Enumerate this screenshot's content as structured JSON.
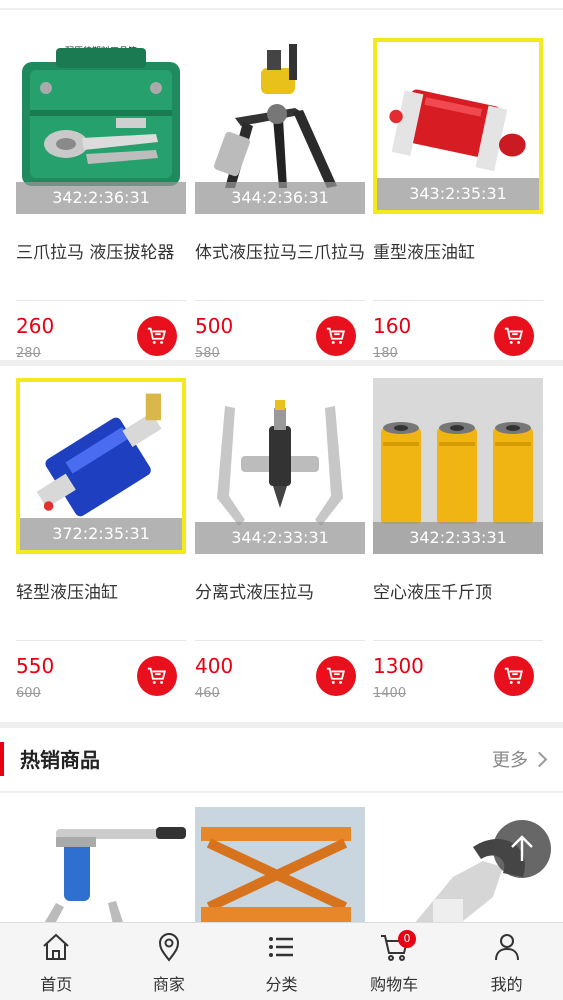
{
  "products_row1": [
    {
      "timer": "342:2:36:31",
      "name": "三爪拉马 液压拔轮器",
      "price": "260",
      "old_price": "280",
      "highlighted": false,
      "image": "green-toolbox-puller-kit",
      "caption": "配原装塑料工具箱"
    },
    {
      "timer": "344:2:36:31",
      "name": "体式液压拉马三爪拉马",
      "price": "500",
      "old_price": "580",
      "highlighted": false,
      "image": "integral-three-jaw-puller"
    },
    {
      "timer": "343:2:35:31",
      "name": "重型液压油缸",
      "price": "160",
      "old_price": "180",
      "highlighted": true,
      "image": "red-hydraulic-cylinder"
    }
  ],
  "products_row2": [
    {
      "timer": "372:2:35:31",
      "name": "轻型液压油缸",
      "price": "550",
      "old_price": "600",
      "highlighted": true,
      "image": "blue-hydraulic-cylinder"
    },
    {
      "timer": "344:2:33:31",
      "name": "分离式液压拉马",
      "price": "400",
      "old_price": "460",
      "highlighted": false,
      "image": "split-hydraulic-puller"
    },
    {
      "timer": "342:2:33:31",
      "name": "空心液压千斤顶",
      "price": "1300",
      "old_price": "1400",
      "highlighted": false,
      "image": "yellow-hollow-jacks"
    }
  ],
  "hot_section": {
    "title": "热销商品",
    "more_label": "更多"
  },
  "tabbar": {
    "items": [
      {
        "label": "首页",
        "icon": "home-icon"
      },
      {
        "label": "商家",
        "icon": "location-pin-icon"
      },
      {
        "label": "分类",
        "icon": "list-icon"
      },
      {
        "label": "购物车",
        "icon": "cart-icon"
      },
      {
        "label": "我的",
        "icon": "user-icon"
      }
    ],
    "cart_badge": "0"
  },
  "colors": {
    "accent": "#e60012",
    "highlight_border": "#f2ea1c",
    "timer_overlay": "#969696"
  }
}
